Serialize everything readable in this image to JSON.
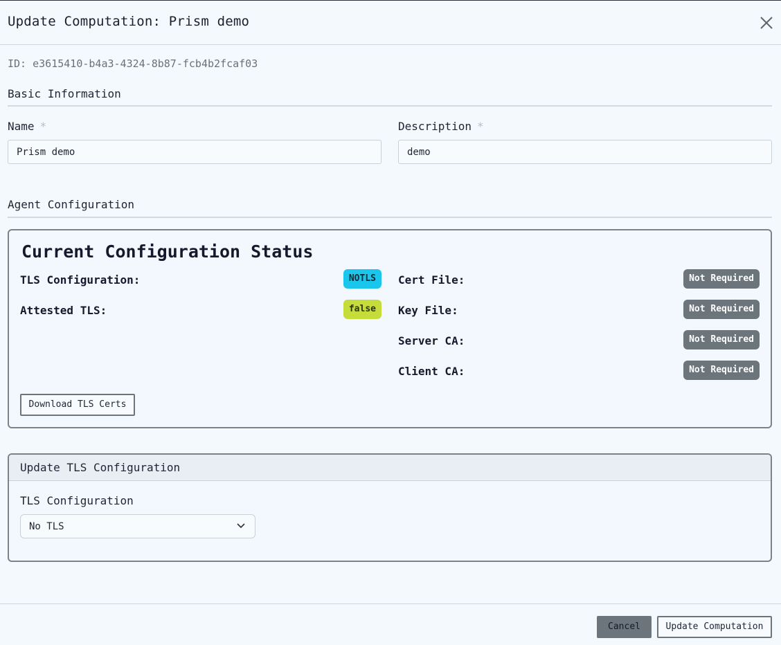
{
  "modal": {
    "title": "Update Computation: Prism demo",
    "id_text": "ID: e3615410-b4a3-4324-8b87-fcb4b2fcaf03"
  },
  "basic_info": {
    "section_title": "Basic Information",
    "name_label": "Name",
    "name_required": "*",
    "name_value": "Prism demo",
    "description_label": "Description",
    "description_required": "*",
    "description_value": "demo"
  },
  "agent_config": {
    "section_title": "Agent Configuration"
  },
  "status_card": {
    "title": "Current Configuration Status",
    "tls_label": "TLS Configuration:",
    "tls_value": "NOTLS",
    "attested_label": "Attested TLS:",
    "attested_value": "false",
    "cert_label": "Cert File:",
    "cert_value": "Not Required",
    "key_label": "Key File:",
    "key_value": "Not Required",
    "server_ca_label": "Server CA:",
    "server_ca_value": "Not Required",
    "client_ca_label": "Client CA:",
    "client_ca_value": "Not Required",
    "download_label": "Download TLS Certs"
  },
  "update_tls": {
    "title": "Update TLS Configuration",
    "field_label": "TLS Configuration",
    "selected_value": "No TLS"
  },
  "footer": {
    "cancel_label": "Cancel",
    "submit_label": "Update Computation"
  },
  "colors": {
    "background": "#f4f9fd",
    "badge_notls": "#1bc6ec",
    "badge_false": "#c5dc3b",
    "badge_not_required": "#6c747c",
    "cancel_button": "#6c747c"
  },
  "icons": {
    "close": "close-icon",
    "select_arrow": "chevron-down-icon"
  }
}
